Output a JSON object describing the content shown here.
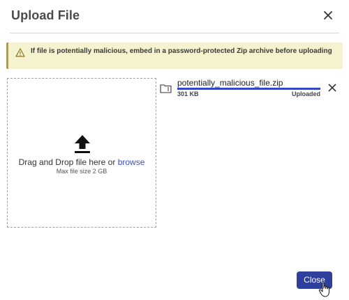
{
  "dialog": {
    "title": "Upload File"
  },
  "warning": {
    "text": "If file is potentially malicious, embed in a password-protected Zip archive before uploading",
    "icon": "warning-icon"
  },
  "dropzone": {
    "prompt": "Drag and Drop file here or ",
    "browse_label": "browse",
    "max_size": "Max file size 2 GB",
    "icon": "upload-icon"
  },
  "file": {
    "name": "potentially_malicious_file.zip",
    "size": "301 KB",
    "status": "Uploaded",
    "progress": 1.0,
    "icon": "folder-zip-icon"
  },
  "footer": {
    "close_label": "Close"
  },
  "colors": {
    "accent": "#2f3f9e",
    "progress": "#3346c9",
    "link": "#3b4cca",
    "warning_bg": "#f5f2cf",
    "warning_border": "#b59a3a"
  }
}
